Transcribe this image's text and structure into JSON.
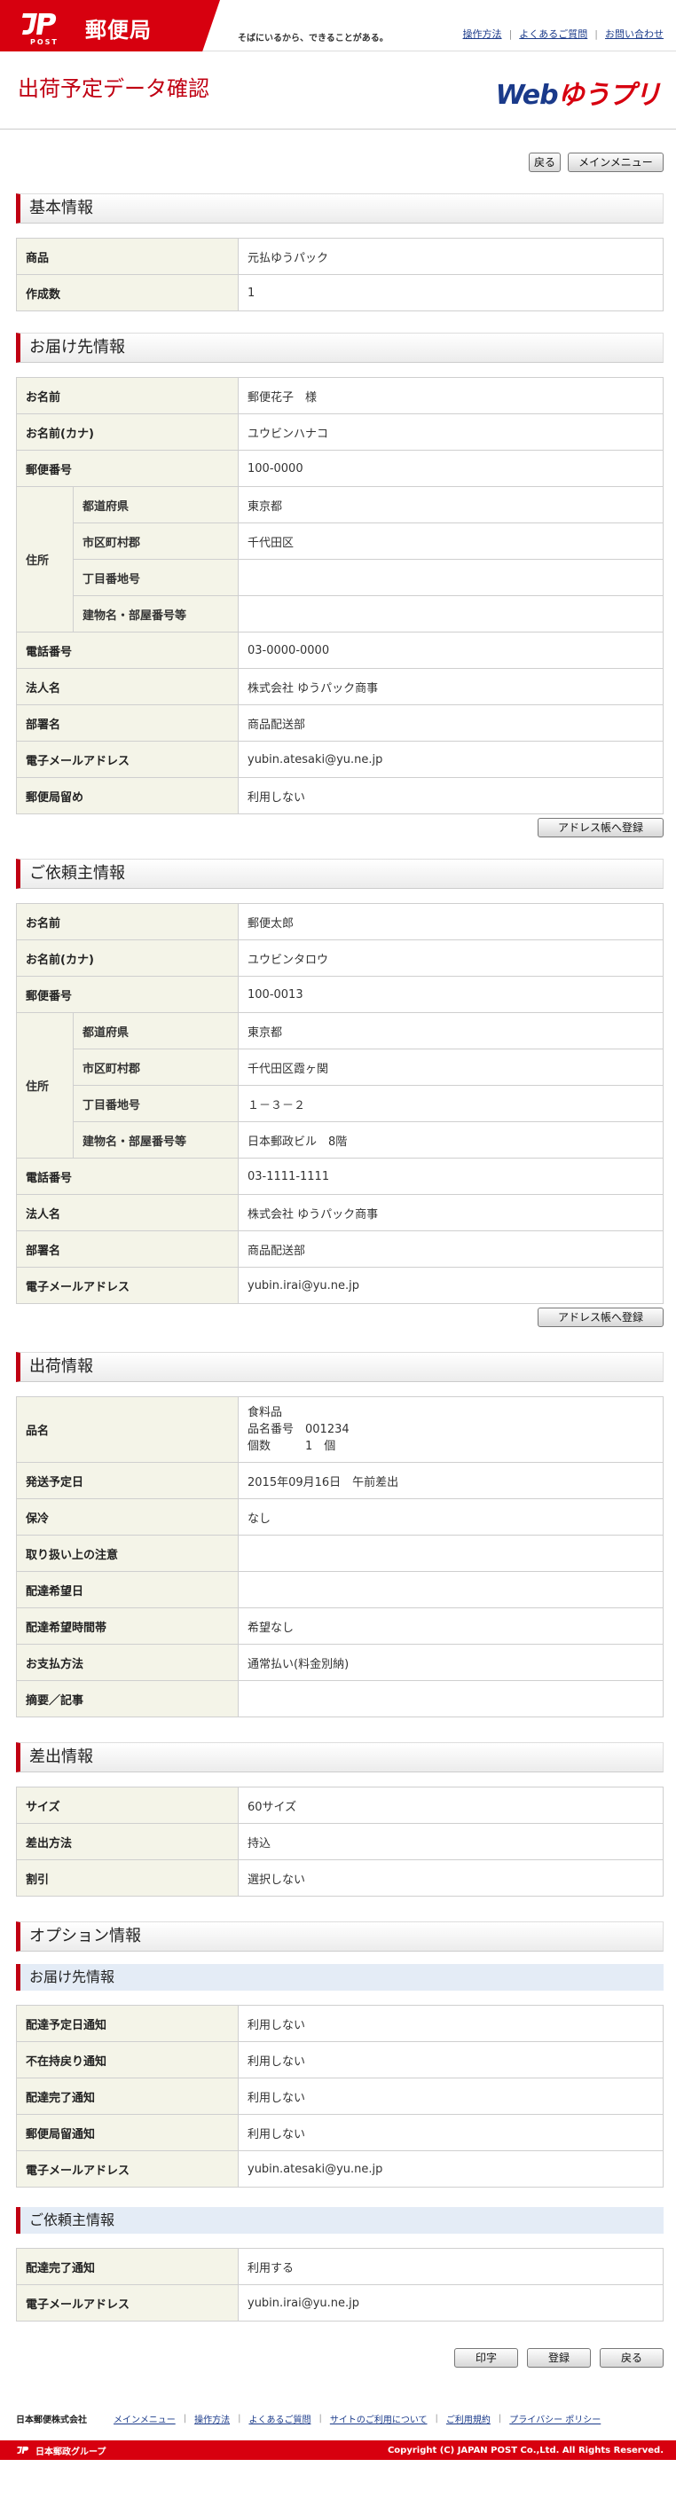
{
  "header": {
    "logo_text": "郵便局",
    "logo_sub": "POST",
    "tagline": "そばにいるから、できることがある。",
    "links": [
      "操作方法",
      "よくあるご質問",
      "お問い合わせ"
    ]
  },
  "title": {
    "page_title": "出荷予定データ確認",
    "brand_web": "Web",
    "brand_name": "ゆうプリ"
  },
  "top_buttons": {
    "back": "戻る",
    "main_menu": "メインメニュー"
  },
  "basic": {
    "heading": "基本情報",
    "rows": [
      {
        "label": "商品",
        "value": "元払ゆうパック"
      },
      {
        "label": "作成数",
        "value": "1"
      }
    ]
  },
  "recipient": {
    "heading": "お届け先情報",
    "name_label": "お名前",
    "name": "郵便花子　様",
    "kana_label": "お名前(カナ)",
    "kana": "ユウビンハナコ",
    "zip_label": "郵便番号",
    "zip": "100-0000",
    "address_label": "住所",
    "pref_label": "都道府県",
    "pref": "東京都",
    "city_label": "市区町村郡",
    "city": "千代田区",
    "block_label": "丁目番地号",
    "block": "",
    "building_label": "建物名・部屋番号等",
    "building": "",
    "tel_label": "電話番号",
    "tel": "03-0000-0000",
    "corp_label": "法人名",
    "corp": "株式会社 ゆうパック商事",
    "dept_label": "部署名",
    "dept": "商品配送部",
    "email_label": "電子メールアドレス",
    "email": "yubin.atesaki@yu.ne.jp",
    "post_label": "郵便局留め",
    "post": "利用しない",
    "register_button": "アドレス帳へ登録"
  },
  "sender": {
    "heading": "ご依頼主情報",
    "name_label": "お名前",
    "name": "郵便太郎",
    "kana_label": "お名前(カナ)",
    "kana": "ユウビンタロウ",
    "zip_label": "郵便番号",
    "zip": "100-0013",
    "address_label": "住所",
    "pref_label": "都道府県",
    "pref": "東京都",
    "city_label": "市区町村郡",
    "city": "千代田区霞ヶ関",
    "block_label": "丁目番地号",
    "block": "１－３－２",
    "building_label": "建物名・部屋番号等",
    "building": "日本郵政ビル　8階",
    "tel_label": "電話番号",
    "tel": "03-1111-1111",
    "corp_label": "法人名",
    "corp": "株式会社 ゆうパック商事",
    "dept_label": "部署名",
    "dept": "商品配送部",
    "email_label": "電子メールアドレス",
    "email": "yubin.irai@yu.ne.jp",
    "register_button": "アドレス帳へ登録"
  },
  "shipment": {
    "heading": "出荷情報",
    "item_label": "品名",
    "item_line1": "食料品",
    "item_line2": "品名番号　001234",
    "item_line3": "個数　　　1　個",
    "date_label": "発送予定日",
    "date": "2015年09月16日　午前差出",
    "cool_label": "保冷",
    "cool": "なし",
    "handling_label": "取り扱い上の注意",
    "handling": "",
    "delivery_date_label": "配達希望日",
    "delivery_date": "",
    "delivery_time_label": "配達希望時間帯",
    "delivery_time": "希望なし",
    "payment_label": "お支払方法",
    "payment": "通常払い(料金別納)",
    "memo_label": "摘要／記事",
    "memo": ""
  },
  "dispatch": {
    "heading": "差出情報",
    "size_label": "サイズ",
    "size": "60サイズ",
    "method_label": "差出方法",
    "method": "持込",
    "discount_label": "割引",
    "discount": "選択しない"
  },
  "options": {
    "heading": "オプション情報",
    "recipient_heading": "お届け先情報",
    "r_schedule_label": "配達予定日通知",
    "r_schedule": "利用しない",
    "r_absent_label": "不在持戻り通知",
    "r_absent": "利用しない",
    "r_complete_label": "配達完了通知",
    "r_complete": "利用しない",
    "r_post_label": "郵便局留通知",
    "r_post": "利用しない",
    "r_email_label": "電子メールアドレス",
    "r_email": "yubin.atesaki@yu.ne.jp",
    "sender_heading": "ご依頼主情報",
    "s_complete_label": "配達完了通知",
    "s_complete": "利用する",
    "s_email_label": "電子メールアドレス",
    "s_email": "yubin.irai@yu.ne.jp"
  },
  "bottom_buttons": {
    "print": "印字",
    "register": "登録",
    "back": "戻る"
  },
  "footer": {
    "org": "日本郵便株式会社",
    "links": [
      "メインメニュー",
      "操作方法",
      "よくあるご質問",
      "サイトのご利用について",
      "ご利用規約",
      "プライバシー ポリシー"
    ],
    "group": "日本郵政グループ",
    "copyright": "Copyright (C) JAPAN POST Co.,Ltd.  All Rights Reserved."
  },
  "colors": {
    "brand_red": "#d7000f",
    "label_bg": "#f4f4e8",
    "link_blue": "#1a3a8a"
  }
}
